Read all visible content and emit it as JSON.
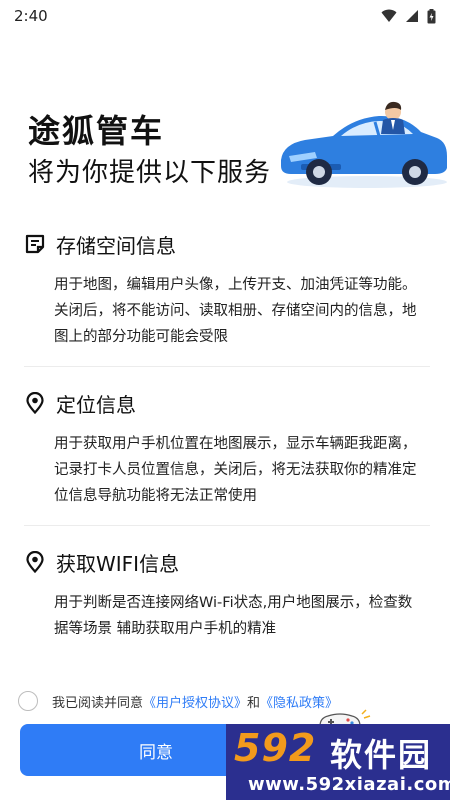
{
  "status_bar": {
    "time": "2:40"
  },
  "hero": {
    "title": "途狐管车",
    "subtitle": "将为你提供以下服务"
  },
  "sections": [
    {
      "title": "存储空间信息",
      "icon": "storage-icon",
      "desc": "用于地图，编辑用户头像，上传开支、加油凭证等功能。关闭后，将不能访问、读取相册、存储空间内的信息，地图上的部分功能可能会受限"
    },
    {
      "title": "定位信息",
      "icon": "location-icon",
      "desc": "用于获取用户手机位置在地图展示，显示车辆距我距离，记录打卡人员位置信息，关闭后，将无法获取你的精准定位信息导航功能将无法正常使用"
    },
    {
      "title": "获取WIFI信息",
      "icon": "location-icon",
      "desc": "用于判断是否连接网络Wi-Fi状态,用户地图展示，检查数据等场景 辅助获取用户手机的精准"
    }
  ],
  "agreement": {
    "prefix": "我已阅读并同意",
    "user_agreement": "《用户授权协议》",
    "and": "和",
    "privacy_policy": "《隐私政策》"
  },
  "agree_button": {
    "label": "同意"
  },
  "watermark": {
    "logo": "592",
    "name": "软件园",
    "url": "www.592xiazai.com"
  },
  "colors": {
    "accent": "#2f7cf6",
    "watermark_bg": "#2b2f8f",
    "watermark_logo": "#f29a1c"
  }
}
